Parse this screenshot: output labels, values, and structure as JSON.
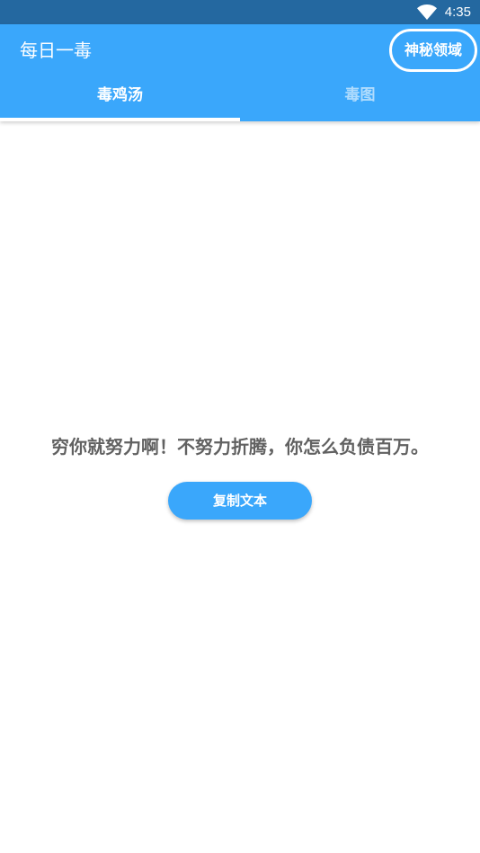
{
  "status_bar": {
    "time": "4:35",
    "icons": [
      "wifi-icon"
    ],
    "background": "#2468a0"
  },
  "app_bar": {
    "title": "每日一毒",
    "mystery_button_label": "神秘领域",
    "background": "#3aa7fb"
  },
  "tabs": [
    {
      "label": "毒鸡汤",
      "selected": true
    },
    {
      "label": "毒图",
      "selected": false
    }
  ],
  "main": {
    "quote": "穷你就努力啊！不努力折腾，你怎么负债百万。",
    "copy_button_label": "复制文本"
  },
  "colors": {
    "accent": "#3aa7fb",
    "quote_text": "#616161"
  }
}
